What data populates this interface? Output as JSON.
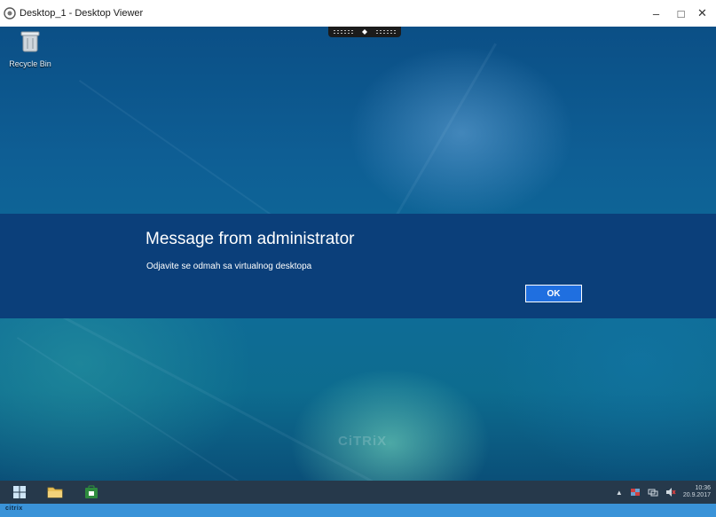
{
  "window": {
    "title": "Desktop_1 - Desktop Viewer",
    "controls": {
      "minimize": "–",
      "maximize": "□",
      "close": "✕"
    }
  },
  "desktop": {
    "recycle_bin_label": "Recycle Bin",
    "watermark": "CiTRiX"
  },
  "dialog": {
    "title": "Message from administrator",
    "message": "Odjavite se odmah sa virtualnog desktopa",
    "ok_label": "OK"
  },
  "taskbar": {
    "items": [
      "start-icon",
      "file-explorer-icon",
      "store-icon"
    ],
    "clock_time": "10:36",
    "clock_date": "20.9.2017"
  },
  "footer": {
    "logo": "citrix"
  },
  "colors": {
    "dialog_bg": "#0b3f7a",
    "ok_button": "#1f6fe0",
    "footer_bar": "#3a93d8"
  }
}
